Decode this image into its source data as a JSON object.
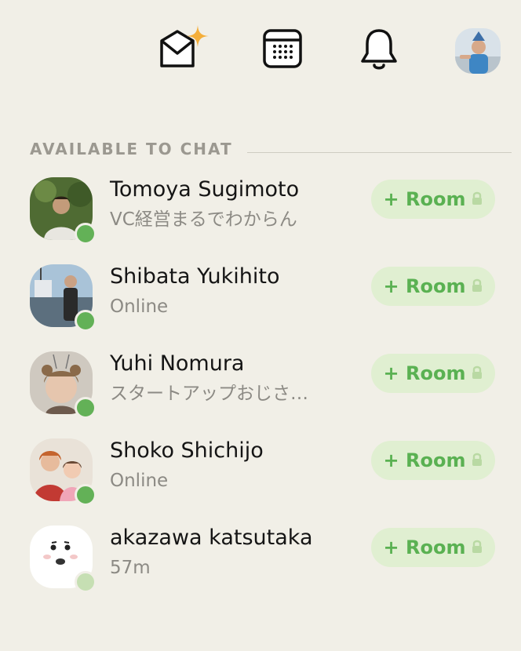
{
  "header": {
    "icons": [
      "envelope-sparkle-icon",
      "calendar-icon",
      "bell-icon",
      "profile-avatar"
    ]
  },
  "section": {
    "title": "AVAILABLE TO CHAT"
  },
  "users": [
    {
      "name": "Tomoya Sugimoto",
      "status": "VC経営まるでわからん",
      "presence": "online"
    },
    {
      "name": "Shibata Yukihito",
      "status": "Online",
      "presence": "online"
    },
    {
      "name": "Yuhi Nomura",
      "status": "スタートアップおじさ…",
      "presence": "online"
    },
    {
      "name": "Shoko Shichijo",
      "status": "Online",
      "presence": "online"
    },
    {
      "name": "akazawa katsutaka",
      "status": "57m",
      "presence": "away"
    }
  ],
  "room_button": {
    "label": "+ Room"
  },
  "colors": {
    "background": "#f1efe7",
    "accent_green": "#5ab152",
    "online_dot": "#63b157",
    "away_dot": "#c6dfb3",
    "room_button_bg": "#e0efd1"
  }
}
